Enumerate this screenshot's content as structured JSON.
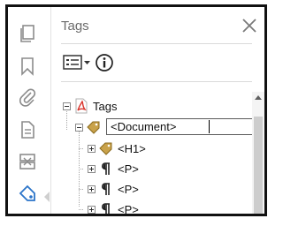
{
  "panel": {
    "title": "Tags",
    "close_icon": "close-icon",
    "options_icon": "tag-options-menu-icon",
    "info_icon": "info-icon"
  },
  "rail": {
    "icons": [
      "page-thumbnails-icon",
      "bookmarks-icon",
      "attachments-icon",
      "document-icon",
      "content-order-icon",
      "tags-icon"
    ],
    "active": "tags-icon",
    "active_color": "#2b74c9"
  },
  "tree": {
    "root": {
      "label": "Tags",
      "icon": "pdf-tags-icon"
    },
    "document": {
      "label": "<Document>",
      "icon": "tag-icon",
      "editing": true
    },
    "children": [
      {
        "label": "<H1>",
        "icon": "tag-icon"
      },
      {
        "label": "<P>",
        "icon": "paragraph-icon"
      },
      {
        "label": "<P>",
        "icon": "paragraph-icon"
      },
      {
        "label": "<P>",
        "icon": "paragraph-icon"
      }
    ]
  },
  "colors": {
    "tag_fill": "#c9a24a",
    "pdf_red": "#d9332b",
    "text": "#111111",
    "title": "#6b6b6b"
  }
}
